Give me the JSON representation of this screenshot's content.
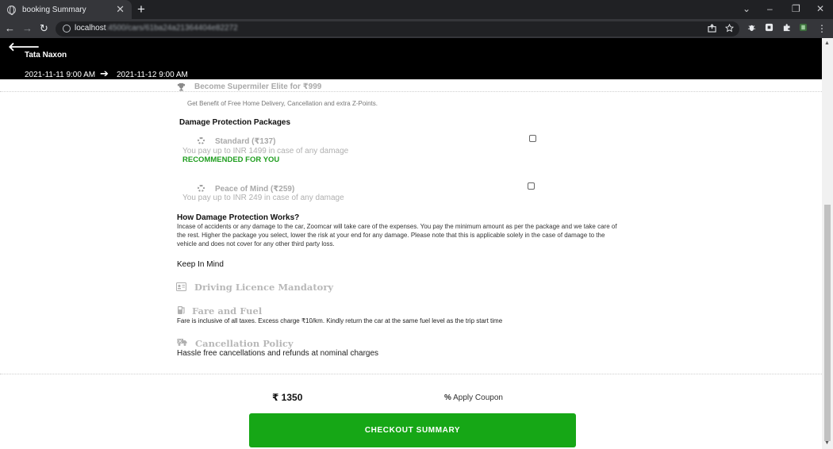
{
  "browser": {
    "tab_title": "booking Summary",
    "url_host": "localhost",
    "url_rest": ":4500/cars/61ba24a21364404e82272"
  },
  "header": {
    "car_name": "Tata Naxon",
    "start_datetime": "2021-11-11 9:00 AM",
    "end_datetime": "2021-11-12 9:00 AM"
  },
  "supermiler": {
    "title": "Become Supermiler Elite for ₹999",
    "description": "Get Benefit of Free Home Delivery, Cancellation and extra Z-Points."
  },
  "damage_protection": {
    "heading": "Damage Protection Packages",
    "packages": [
      {
        "name": "Standard (₹137)",
        "description": "You pay up to INR 1499 in case of any damage",
        "tag": "RECOMMENDED FOR YOU",
        "checked": false
      },
      {
        "name": "Peace of Mind (₹259)",
        "description": "You pay up to INR 249 in case of any damage",
        "checked": false
      }
    ]
  },
  "how_it_works": {
    "heading": "How Damage Protection Works?",
    "lines": [
      "Incase of accidents or any damage to the car, Zoomcar will take care of the expenses. You pay the minimum amount as per the package and we take care of",
      "the rest. Higher the package you select, lower the risk at your end for any damage. Please note that this is applicable solely in the case of damage to the",
      "vehicle and does not cover for any other third party loss."
    ]
  },
  "keep_in_mind": {
    "heading": "Keep In Mind",
    "items": [
      {
        "title": "Driving Licence Mandatory",
        "description": ""
      },
      {
        "title": "Fare and Fuel",
        "description": "Fare is inclusive of all taxes. Excess charge ₹10/km. Kindly return the car at the same fuel level as the trip start time"
      },
      {
        "title": "Cancellation Policy",
        "description": "Hassle free cancellations and refunds at nominal charges"
      }
    ]
  },
  "footer": {
    "price": "₹ 1350",
    "coupon_label": "Apply Coupon",
    "checkout_label": "CHECKOUT SUMMARY"
  },
  "colors": {
    "header_bg": "#000000",
    "checkout_bg": "#16a716",
    "recommended": "#1f9e1f"
  }
}
